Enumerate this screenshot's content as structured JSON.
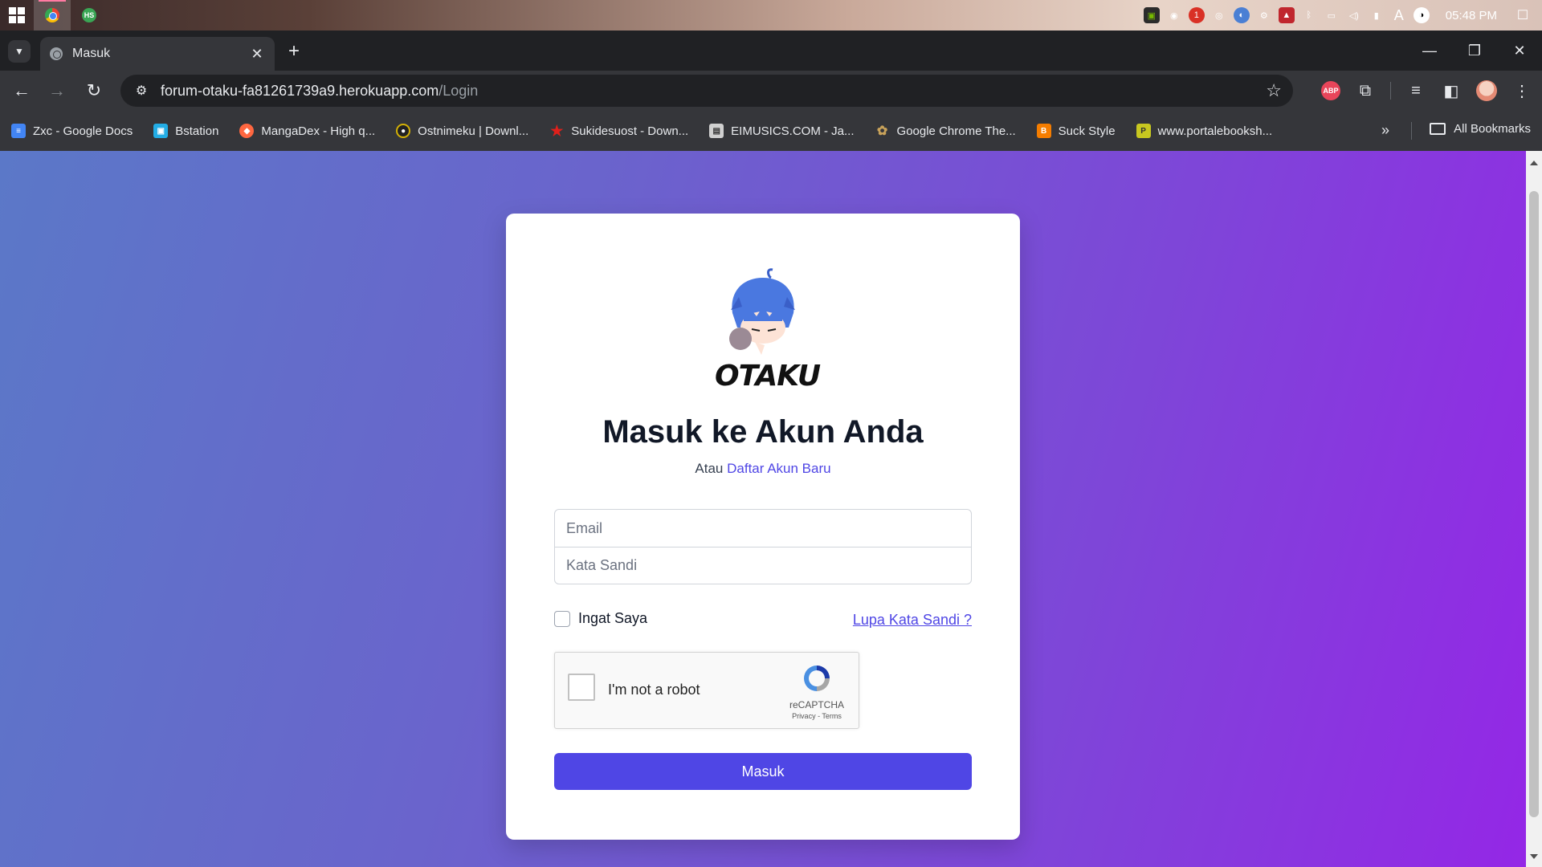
{
  "taskbar": {
    "clock": "05:48 PM",
    "tray_icons": [
      "nvidia-icon",
      "discord-icon",
      "notification-badge-icon",
      "app-icon",
      "app-icon",
      "steam-icon",
      "app-icon",
      "bluetooth-icon",
      "network-icon",
      "volume-icon",
      "battery-icon",
      "font-icon",
      "app-icon"
    ],
    "tray_badge": "1"
  },
  "browser": {
    "tab": {
      "title": "Masuk"
    },
    "new_tab_label": "+",
    "url": {
      "host": "forum-otaku-fa81261739a9.herokuapp.com",
      "path": "/Login"
    },
    "extensions": {
      "abp_label": "ABP"
    },
    "bookmarks": [
      {
        "label": "Zxc - Google Docs",
        "icon": "docs-icon",
        "color": "#4285f4"
      },
      {
        "label": "Bstation",
        "icon": "bstation-icon",
        "color": "#23ade5"
      },
      {
        "label": "MangaDex - High q...",
        "icon": "mangadex-icon",
        "color": "#ff6740"
      },
      {
        "label": "Ostnimeku | Downl...",
        "icon": "ostnimeku-icon",
        "color": "#d4b106"
      },
      {
        "label": "Sukidesuost - Down...",
        "icon": "star-icon",
        "color": "#e0201b"
      },
      {
        "label": "EIMUSICS.COM - Ja...",
        "icon": "eimusics-icon",
        "color": "#d0d0d0"
      },
      {
        "label": "Google Chrome The...",
        "icon": "palette-icon",
        "color": "#c8a25a"
      },
      {
        "label": "Suck Style",
        "icon": "blogger-icon",
        "color": "#f57d00"
      },
      {
        "label": "www.portalebooksh...",
        "icon": "portal-icon",
        "color": "#c8c820"
      }
    ],
    "all_bookmarks_label": "All Bookmarks"
  },
  "page": {
    "logo_text": "OTAKU",
    "heading": "Masuk ke Akun Anda",
    "subline_prefix": "Atau",
    "register_link": "Daftar Akun Baru",
    "email_placeholder": "Email",
    "password_placeholder": "Kata Sandi",
    "remember_label": "Ingat Saya",
    "forgot_link": "Lupa Kata Sandi ?",
    "recaptcha": {
      "label": "I'm not a robot",
      "brand": "reCAPTCHA",
      "privacy": "Privacy",
      "separator": " - ",
      "terms": "Terms"
    },
    "submit_label": "Masuk",
    "accent_color": "#4f46e5"
  }
}
